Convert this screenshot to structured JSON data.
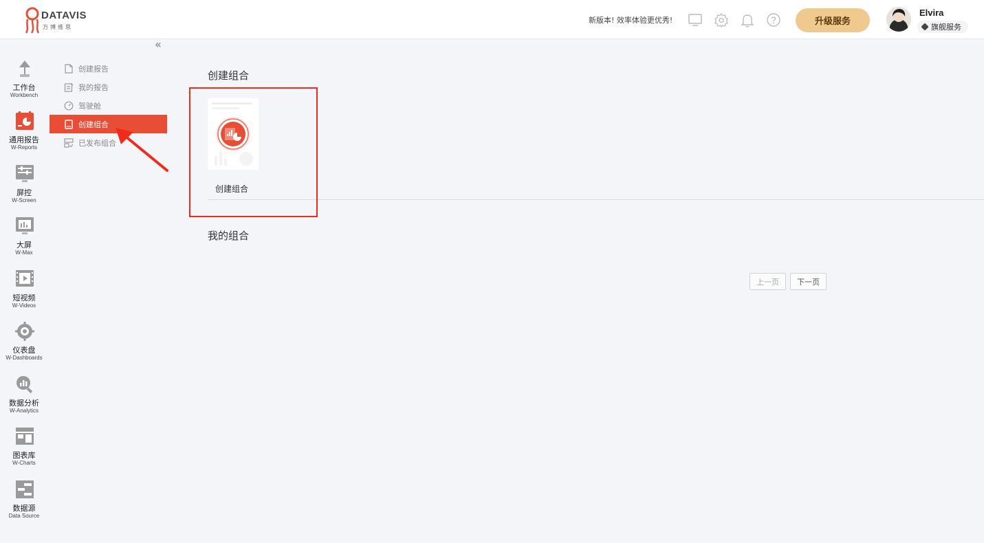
{
  "header": {
    "logo_text": "DATAVIS",
    "logo_subtext": "万博维思",
    "new_version_text": "新版本! 效率体验更优秀!",
    "icons": [
      "monitor-icon",
      "gear-icon",
      "bell-icon",
      "help-icon"
    ],
    "upgrade_label": "升级服务",
    "user_name": "Elvira",
    "user_plan": "旗舰服务",
    "accent_color": "#f0c98e"
  },
  "rail": {
    "items": [
      {
        "cn": "工作台",
        "en": "Workbench",
        "icon": "desk-lamp-icon"
      },
      {
        "cn": "通用报告",
        "en": "W-Reports",
        "icon": "reports-icon",
        "active": true
      },
      {
        "cn": "屏控",
        "en": "W-Screen",
        "icon": "screen-control-icon"
      },
      {
        "cn": "大屏",
        "en": "W-Max",
        "icon": "big-screen-icon"
      },
      {
        "cn": "短视频",
        "en": "W-Videos",
        "icon": "video-icon"
      },
      {
        "cn": "仪表盘",
        "en": "W-Dashboards",
        "icon": "dashboard-gear-icon"
      },
      {
        "cn": "数据分析",
        "en": "W-Analytics",
        "icon": "analytics-icon"
      },
      {
        "cn": "图表库",
        "en": "W-Charts",
        "icon": "charts-icon"
      },
      {
        "cn": "数据源",
        "en": "Data Source",
        "icon": "data-source-icon"
      }
    ]
  },
  "submenu": {
    "collapse_glyph": "«",
    "items": [
      {
        "label": "创建报告",
        "icon": "new-document-icon"
      },
      {
        "label": "我的报告",
        "icon": "edit-document-icon"
      },
      {
        "label": "驾驶舱",
        "icon": "speedometer-icon"
      },
      {
        "label": "创建组合",
        "icon": "book-icon",
        "active": true
      },
      {
        "label": "已发布组合",
        "icon": "published-icon"
      }
    ]
  },
  "main": {
    "create_title": "创建组合",
    "card_label": "创建组合",
    "my_title": "我的组合",
    "prev_label": "上一页",
    "next_label": "下一页"
  },
  "colors": {
    "active_menu": "#e84e35",
    "highlight_border": "#f02b1b"
  }
}
